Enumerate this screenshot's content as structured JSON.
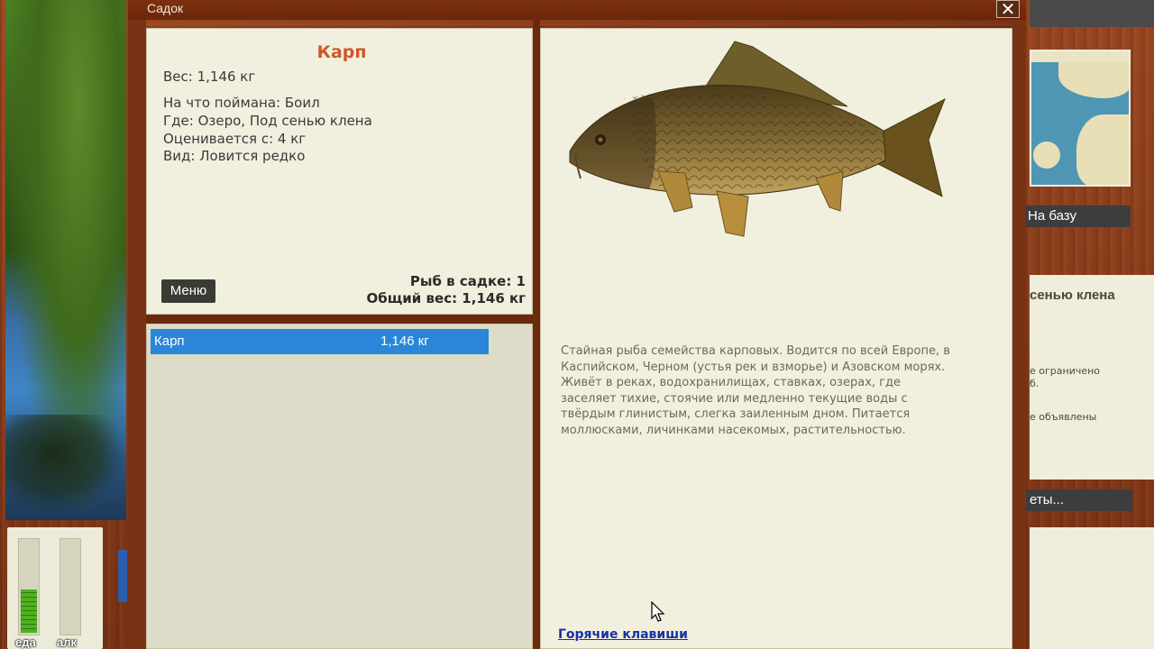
{
  "window": {
    "title": "Садок",
    "close_glyph": "✕"
  },
  "fish": {
    "name": "Карп",
    "weight_line": "Вес: 1,146 кг",
    "bait_line": "На что поймана: Боил",
    "place_line": "Где: Озеро, Под сенью клена",
    "rated_line": "Оценивается с: 4 кг",
    "kind_line": "Вид: Ловится редко",
    "description": "Стайная рыба семейства карповых. Водится по всей Европе, в Каспийском, Черном (устья рек и взморье) и Азовском морях. Живёт в реках, водохранилищах, ставках, озерах, где заселяет тихие, стоячие или медленно текущие воды с твёрдым глинистым, слегка заиленным дном. Питается  моллюсками, личинками насекомых, растительностью."
  },
  "menu_button": "Меню",
  "totals": {
    "count_line": "Рыб в садке: 1",
    "weight_line": "Общий вес: 1,146 кг"
  },
  "catch_list": [
    {
      "name": "Карп",
      "weight": "1,146 кг",
      "selected": true
    }
  ],
  "hotkeys_link": "Горячие клавиши",
  "background": {
    "needs": [
      {
        "label": "еда",
        "level": 0.45
      },
      {
        "label": "алк",
        "level": 0.0
      }
    ],
    "to_base_button": "На базу",
    "location_heading": "сенью клена",
    "info_line_1": "е ограничено",
    "info_line_2": "б.",
    "info_line_3": "е объявлены",
    "reports_button": "еты..."
  },
  "colors": {
    "fish_name": "#d0572a",
    "selection": "#2a86d8",
    "link": "#1a2ea8",
    "panel": "#f1f0de"
  }
}
